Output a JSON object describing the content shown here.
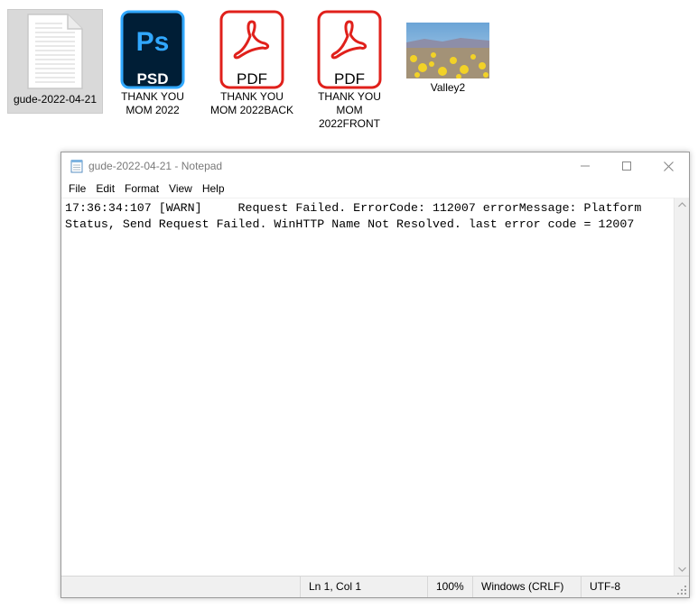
{
  "desktop": {
    "icons": [
      {
        "label": "gude-2022-04-21",
        "icon": "text-file-icon",
        "selected": true
      },
      {
        "label": "THANK YOU MOM 2022",
        "icon": "photoshop-psd-icon",
        "badge_top": "Ps",
        "badge_bottom": "PSD"
      },
      {
        "label": "THANK YOU MOM 2022BACK",
        "icon": "pdf-file-icon",
        "badge_bottom": "PDF"
      },
      {
        "label": "THANK YOU MOM 2022FRONT",
        "icon": "pdf-file-icon",
        "badge_bottom": "PDF"
      },
      {
        "label": "Valley2",
        "icon": "image-thumbnail-icon"
      }
    ]
  },
  "notepad": {
    "title": "gude-2022-04-21 - Notepad",
    "menu": [
      "File",
      "Edit",
      "Format",
      "View",
      "Help"
    ],
    "content": "17:36:34:107 [WARN]     Request Failed. ErrorCode: 112007 errorMessage: Platform Status, Send Request Failed. WinHTTP Name Not Resolved. last error code = 12007",
    "status": {
      "position": "Ln 1, Col 1",
      "zoom": "100%",
      "line_ending": "Windows (CRLF)",
      "encoding": "UTF-8"
    }
  },
  "colors": {
    "pdf_red": "#e0201b",
    "psd_dark": "#001e36",
    "psd_blue": "#31a8ff",
    "window_border": "#9a9a9a",
    "status_bg": "#f0f0f0"
  }
}
